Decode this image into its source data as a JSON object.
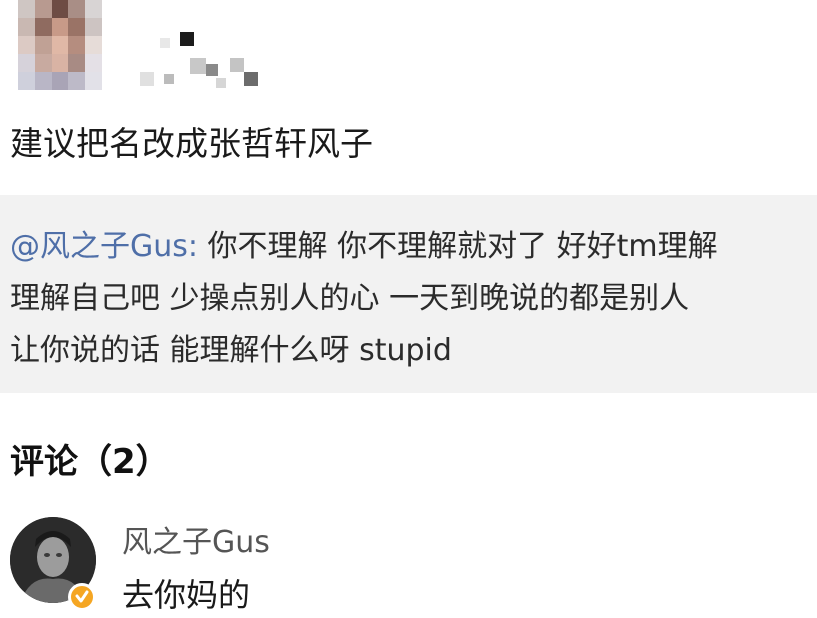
{
  "post": {
    "text": "建议把名改成张哲轩风子"
  },
  "repost": {
    "mention": "@风之子Gus:",
    "line1": " 你不理解 你不理解就对了 好好tm理解",
    "line2": "理解自己吧 少操点别人的心 一天到晚说的都是别人",
    "line3": "让你说的话 能理解什么呀 stupid"
  },
  "comments": {
    "heading": "评论（2）",
    "items": [
      {
        "author": "风之子Gus",
        "text": "去你妈的",
        "verified_icon": "verified-badge-icon"
      }
    ]
  },
  "colors": {
    "mention": "#4f6fa8",
    "repost_background": "#f2f2f2",
    "verified_badge": "#f5a623"
  }
}
